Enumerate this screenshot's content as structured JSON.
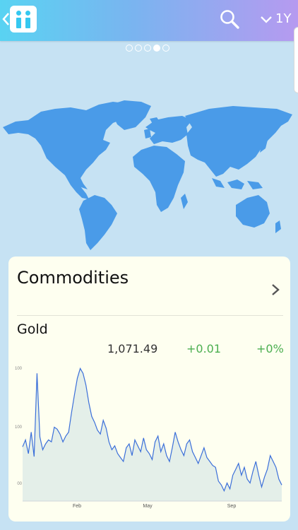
{
  "header": {
    "back_icon": "chevron-left-icon",
    "logo_icon": "ii-logo-icon",
    "search_icon": "search-icon",
    "period_icon": "chevron-down-icon",
    "period_label": "1Y"
  },
  "pager": {
    "count": 5,
    "active_index": 3
  },
  "map": {
    "icon": "world-map",
    "color": "#4a9be8"
  },
  "card": {
    "title": "Commodities",
    "chevron_icon": "chevron-right-icon",
    "item": {
      "name": "Gold",
      "price": "1,071.49",
      "change": "+0.01",
      "change_pct": "+0%"
    }
  },
  "colors": {
    "accent_start": "#59d3f2",
    "accent_end": "#b69af0",
    "positive": "#4caf50",
    "line": "#3b6fd9",
    "fill": "#e4efe9"
  },
  "chart_data": {
    "type": "area",
    "x_ticks": [
      "Feb",
      "May",
      "Sep"
    ],
    "y_ticks": [
      "00",
      "100",
      "100"
    ],
    "series": [
      {
        "values": [
          1105,
          1112,
          1098,
          1120,
          1095,
          1180,
          1115,
          1102,
          1108,
          1112,
          1110,
          1125,
          1123,
          1118,
          1110,
          1116,
          1120,
          1140,
          1158,
          1175,
          1185,
          1180,
          1168,
          1150,
          1136,
          1130,
          1122,
          1118,
          1132,
          1124,
          1110,
          1102,
          1106,
          1098,
          1094,
          1090,
          1104,
          1108,
          1096,
          1112,
          1106,
          1100,
          1114,
          1102,
          1098,
          1092,
          1110,
          1116,
          1100,
          1108,
          1096,
          1090,
          1104,
          1120,
          1110,
          1102,
          1096,
          1108,
          1112,
          1100,
          1094,
          1088,
          1096,
          1104,
          1094,
          1090,
          1086,
          1084,
          1070,
          1066,
          1060,
          1068,
          1062,
          1076,
          1082,
          1088,
          1076,
          1084,
          1072,
          1068,
          1080,
          1090,
          1076,
          1064,
          1074,
          1082,
          1096,
          1090,
          1084,
          1072,
          1066
        ]
      }
    ]
  }
}
